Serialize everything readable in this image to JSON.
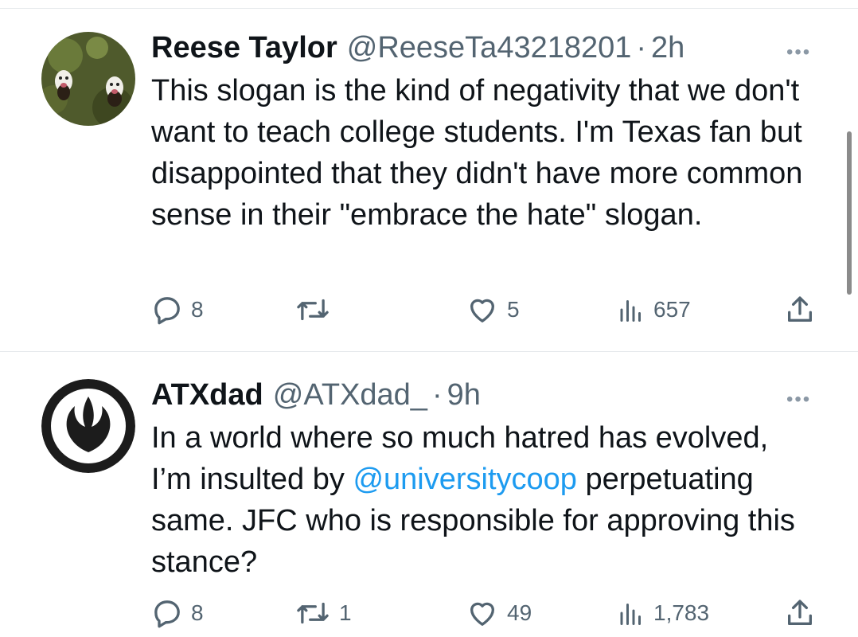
{
  "tweets": [
    {
      "name": "Reese Taylor",
      "handle": "@ReeseTa43218201",
      "separator": "·",
      "time": "2h",
      "text": "This slogan is the kind of negativity that we don't want to teach college students.  I'm Texas fan but disappointed that they didn't have more common sense in their \"embrace the hate\" slogan.",
      "replies": "8",
      "retweets": "",
      "likes": "5",
      "views": "657",
      "avatar_icon": "dogs-photo-avatar"
    },
    {
      "name": "ATXdad",
      "handle": "@ATXdad_",
      "separator": "·",
      "time": "9h",
      "text_before": "In a world where so much hatred has evolved, I’m insulted by ",
      "mention": "@universitycoop",
      "text_after": " perpetuating same.  JFC who is responsible for approving this stance?",
      "replies": "8",
      "retweets": "1",
      "likes": "49",
      "views": "1,783",
      "avatar_icon": "rebel-alliance-icon"
    }
  ],
  "colors": {
    "text": "#0f1419",
    "secondary": "#536471",
    "mention": "#1d9bf0",
    "divider": "#e6e9ec"
  }
}
